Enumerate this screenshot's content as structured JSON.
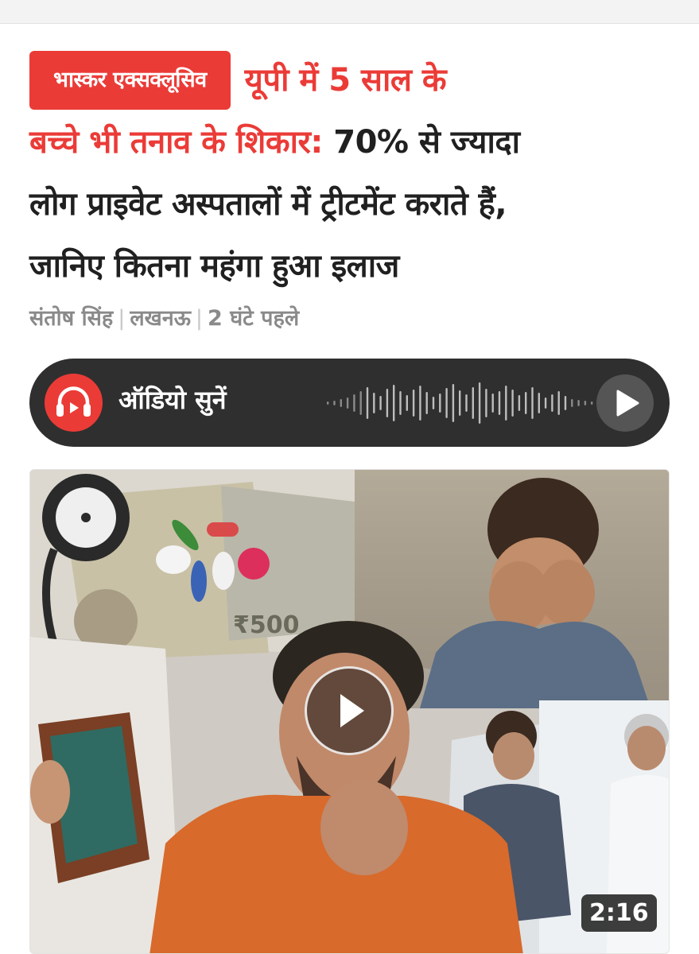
{
  "article": {
    "badge": "भास्कर एक्सक्लूसिव",
    "headline_accent_1": "यूपी में 5 साल के",
    "headline_accent_2": "बच्चे भी तनाव के शिकार:",
    "headline_rest_1": "70% से ज्यादा",
    "headline_rest_2": "लोग प्राइवेट अस्पतालों में ट्रीटमेंट कराते हैं,",
    "headline_rest_3": "जानिए कितना महंगा हुआ इलाज",
    "author": "संतोष सिंह",
    "location": "लखनऊ",
    "time": "2 घंटे पहले"
  },
  "audio": {
    "label": "ऑडियो सुनें",
    "icon": "headphones-icon",
    "play_icon": "play-icon"
  },
  "video": {
    "duration": "2:16",
    "play_icon": "play-icon"
  },
  "colors": {
    "accent": "#eb3b37",
    "audio_bar": "#2f2f2f",
    "text": "#202020",
    "meta": "#8a8a8a"
  }
}
